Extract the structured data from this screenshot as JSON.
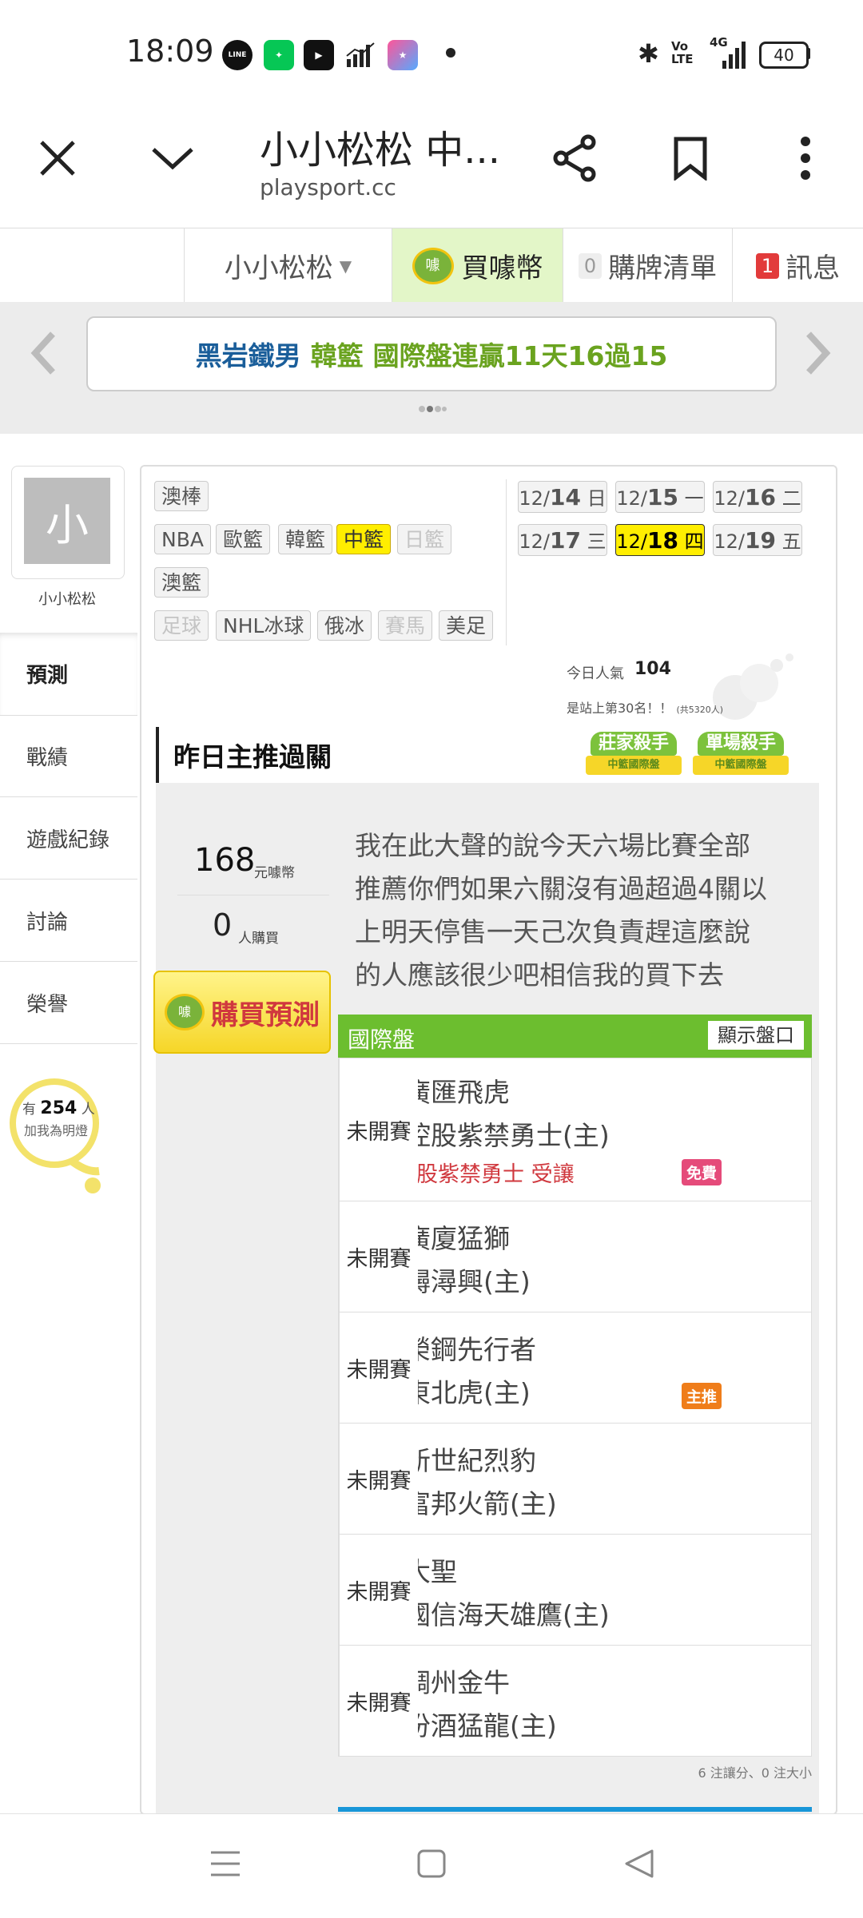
{
  "status_bar": {
    "time": "18:09",
    "line_label": "LINE",
    "battery": "40",
    "network": "4G",
    "volte": "Vo LTE"
  },
  "browser": {
    "title": "小小松松 中...",
    "url": "playsport.cc"
  },
  "site_nav": {
    "user_menu": "小小松松",
    "buy_coins": "買噱幣",
    "coin_icon_text": "噱",
    "cart_count": "0",
    "cart_label": "購牌清單",
    "msg_count": "1",
    "msg_label": "訊息"
  },
  "banner": {
    "part1": "黑岩鐵男",
    "part2": "韓籃",
    "part3": "國際盤連贏11天16過15"
  },
  "profile": {
    "avatar_char": "小",
    "name": "小小松松"
  },
  "left_menu": [
    "預測",
    "戰績",
    "遊戲紀錄",
    "討論",
    "榮譽"
  ],
  "light": {
    "prefix": "有",
    "count": "254",
    "unit": "人",
    "caption": "加我為明燈"
  },
  "leagues": [
    [
      "澳棒"
    ],
    [
      "NBA",
      "歐籃",
      "韓籃",
      "中籃",
      "日籃"
    ],
    [
      "澳籃"
    ],
    [
      "足球",
      "NHL冰球",
      "俄冰",
      "賽馬",
      "美足"
    ]
  ],
  "dates": [
    {
      "month": "12/",
      "day": "14",
      "dow": "日"
    },
    {
      "month": "12/",
      "day": "15",
      "dow": "一"
    },
    {
      "month": "12/",
      "day": "16",
      "dow": "二"
    },
    {
      "month": "12/",
      "day": "17",
      "dow": "三"
    },
    {
      "month": "12/",
      "day": "18",
      "dow": "四"
    },
    {
      "month": "12/",
      "day": "19",
      "dow": "五"
    }
  ],
  "popularity": {
    "label": "今日人氣",
    "value": "104",
    "rank": "是站上第30名！！",
    "total": "(共5320人)"
  },
  "section": {
    "title": "昨日主推過關",
    "award1_top": "莊家殺手",
    "award1_bottom": "中籃國際盤",
    "award2_top": "單場殺手",
    "award2_bottom": "中籃國際盤"
  },
  "price": {
    "value": "168",
    "unit": "元噱幣",
    "buyers": "0",
    "buyers_unit": "人購買",
    "buy_button": "購買預測",
    "coin_text": "噱"
  },
  "message": [
    "我在此大聲的說今天六場比賽全部",
    "推薦你們如果六關沒有過超過4關以",
    "上明天停售一天己次負責趕這麼說",
    "的人應該很少吧相信我的買下去"
  ],
  "table": {
    "header": "國際盤",
    "show_button": "顯示盤口",
    "games": [
      {
        "away": "新疆廣匯飛虎",
        "home": "北京控股紫禁勇士(主)",
        "pick": "北京控股紫禁勇士 受讓",
        "badge": "免費",
        "status": "未開賽"
      },
      {
        "away": "浙江廣廈猛獅",
        "home": "福建鱘潯興(主)",
        "status": "未開賽"
      },
      {
        "away": "天津榮鋼先行者",
        "home": "吉林東北虎(主)",
        "badge": "主推",
        "status": "未開賽"
      },
      {
        "away": "深圳新世紀烈豹",
        "home": "寧波富邦火箭(主)",
        "status": "未開賽"
      },
      {
        "away": "南京大聖",
        "home": "青島國信海天雄鷹(主)",
        "status": "未開賽"
      },
      {
        "away": "浙江稠州金牛",
        "home": "山西汾酒猛龍(主)",
        "status": "未開賽"
      }
    ],
    "footer": "6 注讓分、0 注大小"
  },
  "colors": {
    "green": "#6cbe2f",
    "yellow": "#ffee00",
    "red": "#d0383e",
    "orange": "#ef7d1a",
    "pink": "#e54b7a",
    "blue": "#1896d8"
  }
}
